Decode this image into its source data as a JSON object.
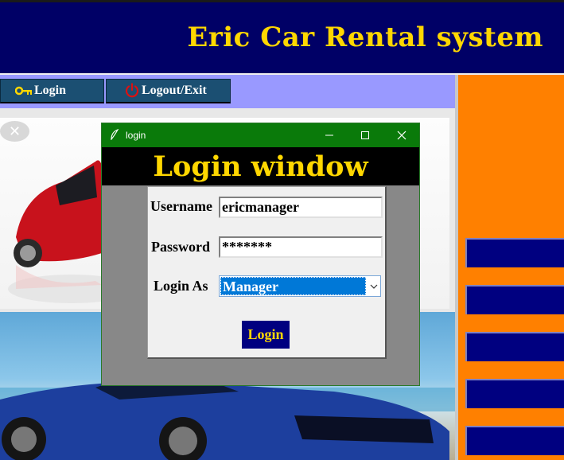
{
  "app": {
    "title": "Eric Car Rental system"
  },
  "nav": {
    "login_label": "Login",
    "logout_label": "Logout/Exit"
  },
  "dialog": {
    "window_title": "login",
    "heading": "Login window",
    "username_label": "Username",
    "username_value": "ericmanager",
    "password_label": "Password",
    "password_value": "*******",
    "login_as_label": "Login As",
    "login_as_value": "Manager",
    "submit_label": "Login"
  },
  "colors": {
    "header_bg": "#000066",
    "title_gold": "#FFD700",
    "dialog_titlebar": "#0a7a0a",
    "side_panel": "#ff8000",
    "side_button": "#000080"
  }
}
